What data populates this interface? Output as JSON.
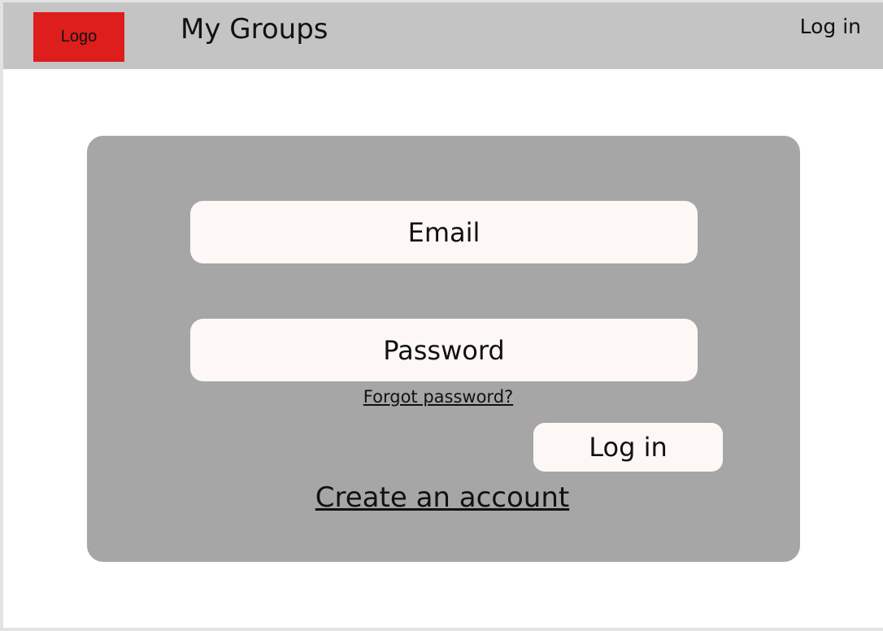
{
  "header": {
    "logo_label": "Logo",
    "title": "My Groups",
    "login_link": "Log in"
  },
  "login_form": {
    "email_placeholder": "Email",
    "password_placeholder": "Password",
    "forgot_password": "Forgot password?",
    "login_button": "Log in",
    "create_account": "Create an account"
  },
  "colors": {
    "header_background": "#c4c4c4",
    "logo_background": "#de1d1d",
    "panel_background": "#a6a6a6",
    "field_background": "#fdf8f6"
  }
}
